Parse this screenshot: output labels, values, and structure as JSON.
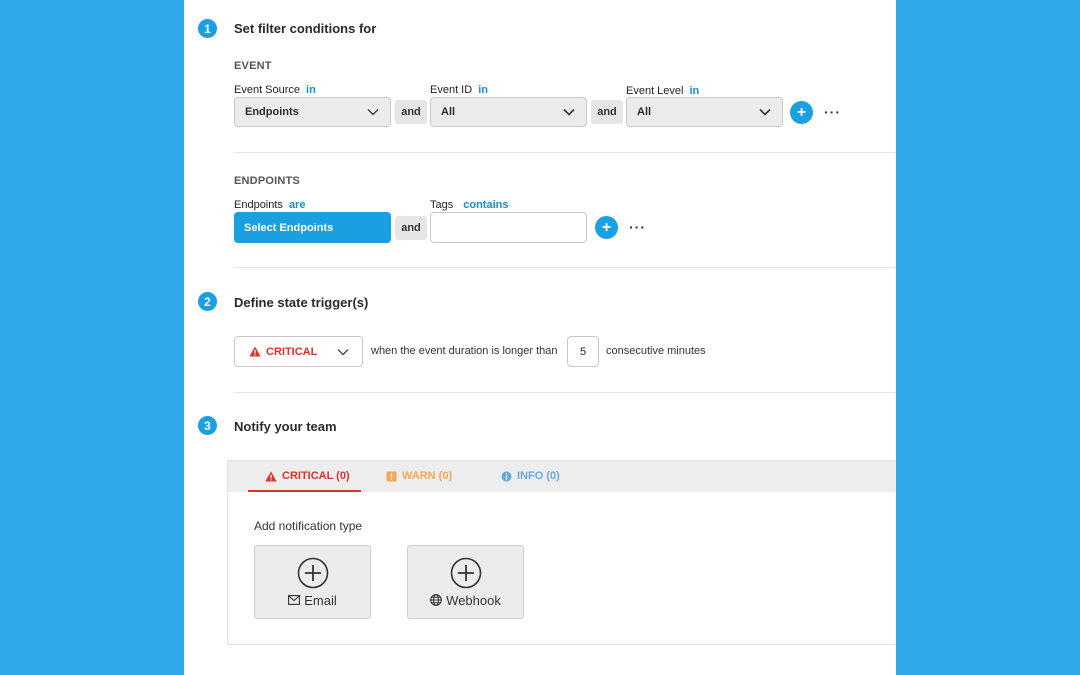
{
  "step1": {
    "number": "1",
    "title": "Set filter conditions for",
    "event_section": {
      "label": "EVENT",
      "source": {
        "label": "Event Source",
        "operator": "in",
        "value": "Endpoints"
      },
      "and1": "and",
      "id": {
        "label": "Event ID",
        "operator": "in",
        "value": "All"
      },
      "and2": "and",
      "level": {
        "label": "Event Level",
        "operator": "in",
        "value": "All"
      },
      "add_icon": "plus-icon",
      "more": "···"
    },
    "endpoints_section": {
      "label": "ENDPOINTS",
      "endpoints": {
        "label": "Endpoints",
        "operator": "are",
        "button": "Select Endpoints"
      },
      "and": "and",
      "tags": {
        "label": "Tags",
        "operator": "contains",
        "value": ""
      },
      "add_icon": "plus-icon",
      "more": "···"
    }
  },
  "step2": {
    "number": "2",
    "title": "Define state trigger(s)",
    "severity": "CRITICAL",
    "text_before": "when the event duration is longer than",
    "duration": "5",
    "text_after": "consecutive minutes"
  },
  "step3": {
    "number": "3",
    "title": "Notify your team",
    "tabs": [
      {
        "label": "CRITICAL (0)",
        "icon": "warning-triangle-icon",
        "color": "#d9322a",
        "active": true
      },
      {
        "label": "WARN (0)",
        "icon": "warn-square-icon",
        "color": "#f0a858",
        "active": false
      },
      {
        "label": "INFO (0)",
        "icon": "info-circle-icon",
        "color": "#6aa8dc",
        "active": false
      }
    ],
    "add_label": "Add notification type",
    "cards": [
      {
        "label": "Email",
        "icon": "envelope-icon"
      },
      {
        "label": "Webhook",
        "icon": "globe-icon"
      }
    ]
  },
  "colors": {
    "background": "#2ea8e8",
    "accent": "#1a9fe0",
    "critical": "#d9322a",
    "warn": "#f0a858",
    "info": "#6aa8dc"
  }
}
